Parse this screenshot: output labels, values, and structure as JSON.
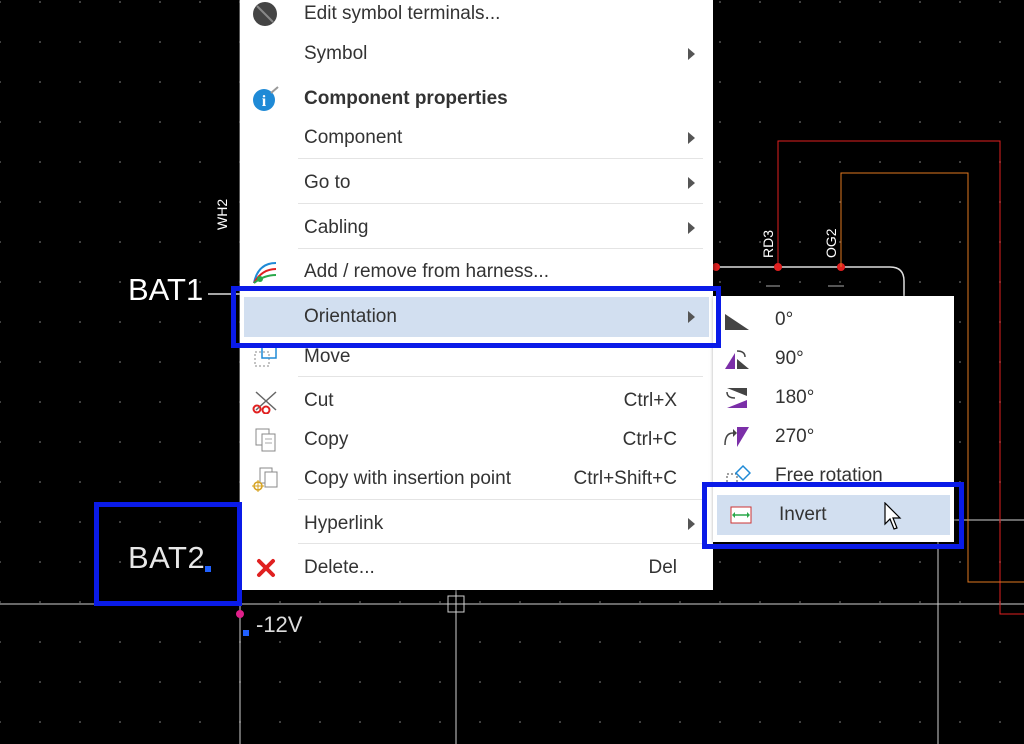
{
  "canvas": {
    "labels": {
      "bat1": "BAT1",
      "bat2": "BAT2",
      "v12": "-12V",
      "wh2": "WH2",
      "rd3": "RD3",
      "og2": "OG2"
    }
  },
  "context_menu": {
    "items": [
      {
        "label": "Edit symbol terminals...",
        "icon": "terminal-icon"
      },
      {
        "label": "Symbol",
        "submenu": true
      },
      {
        "label": "Component properties",
        "icon": "info-icon",
        "bold": true
      },
      {
        "label": "Component",
        "submenu": true
      },
      {
        "label": "Go to",
        "submenu": true
      },
      {
        "label": "Cabling",
        "submenu": true
      },
      {
        "label": "Add / remove from harness...",
        "icon": "harness-icon"
      },
      {
        "label": "Orientation",
        "submenu": true,
        "highlighted": true
      },
      {
        "label": "Move",
        "icon": "move-icon"
      },
      {
        "label": "Cut",
        "shortcut": "Ctrl+X",
        "icon": "scissors-icon"
      },
      {
        "label": "Copy",
        "shortcut": "Ctrl+C",
        "icon": "copy-icon"
      },
      {
        "label": "Copy with insertion point",
        "shortcut": "Ctrl+Shift+C",
        "icon": "copy-insertion-icon"
      },
      {
        "label": "Hyperlink",
        "submenu": true
      },
      {
        "label": "Delete...",
        "shortcut": "Del",
        "icon": "delete-icon"
      }
    ]
  },
  "orientation_submenu": {
    "items": [
      {
        "label": "0°",
        "icon": "rotate-0-icon"
      },
      {
        "label": "90°",
        "icon": "rotate-90-icon"
      },
      {
        "label": "180°",
        "icon": "rotate-180-icon"
      },
      {
        "label": "270°",
        "icon": "rotate-270-icon"
      },
      {
        "label": "Free rotation",
        "icon": "free-rotation-icon"
      },
      {
        "label": "Invert",
        "icon": "invert-icon",
        "highlighted": true
      }
    ]
  },
  "colors": {
    "highlight_box": "#0a1be8",
    "menu_hover": "#d2dff0",
    "wire_red": "#e02020",
    "wire_orange": "#e07820",
    "node_pink": "#e0208a",
    "accent_purple": "#7b2fa8",
    "delete_red": "#e02020",
    "info_blue": "#1f8ad6"
  }
}
